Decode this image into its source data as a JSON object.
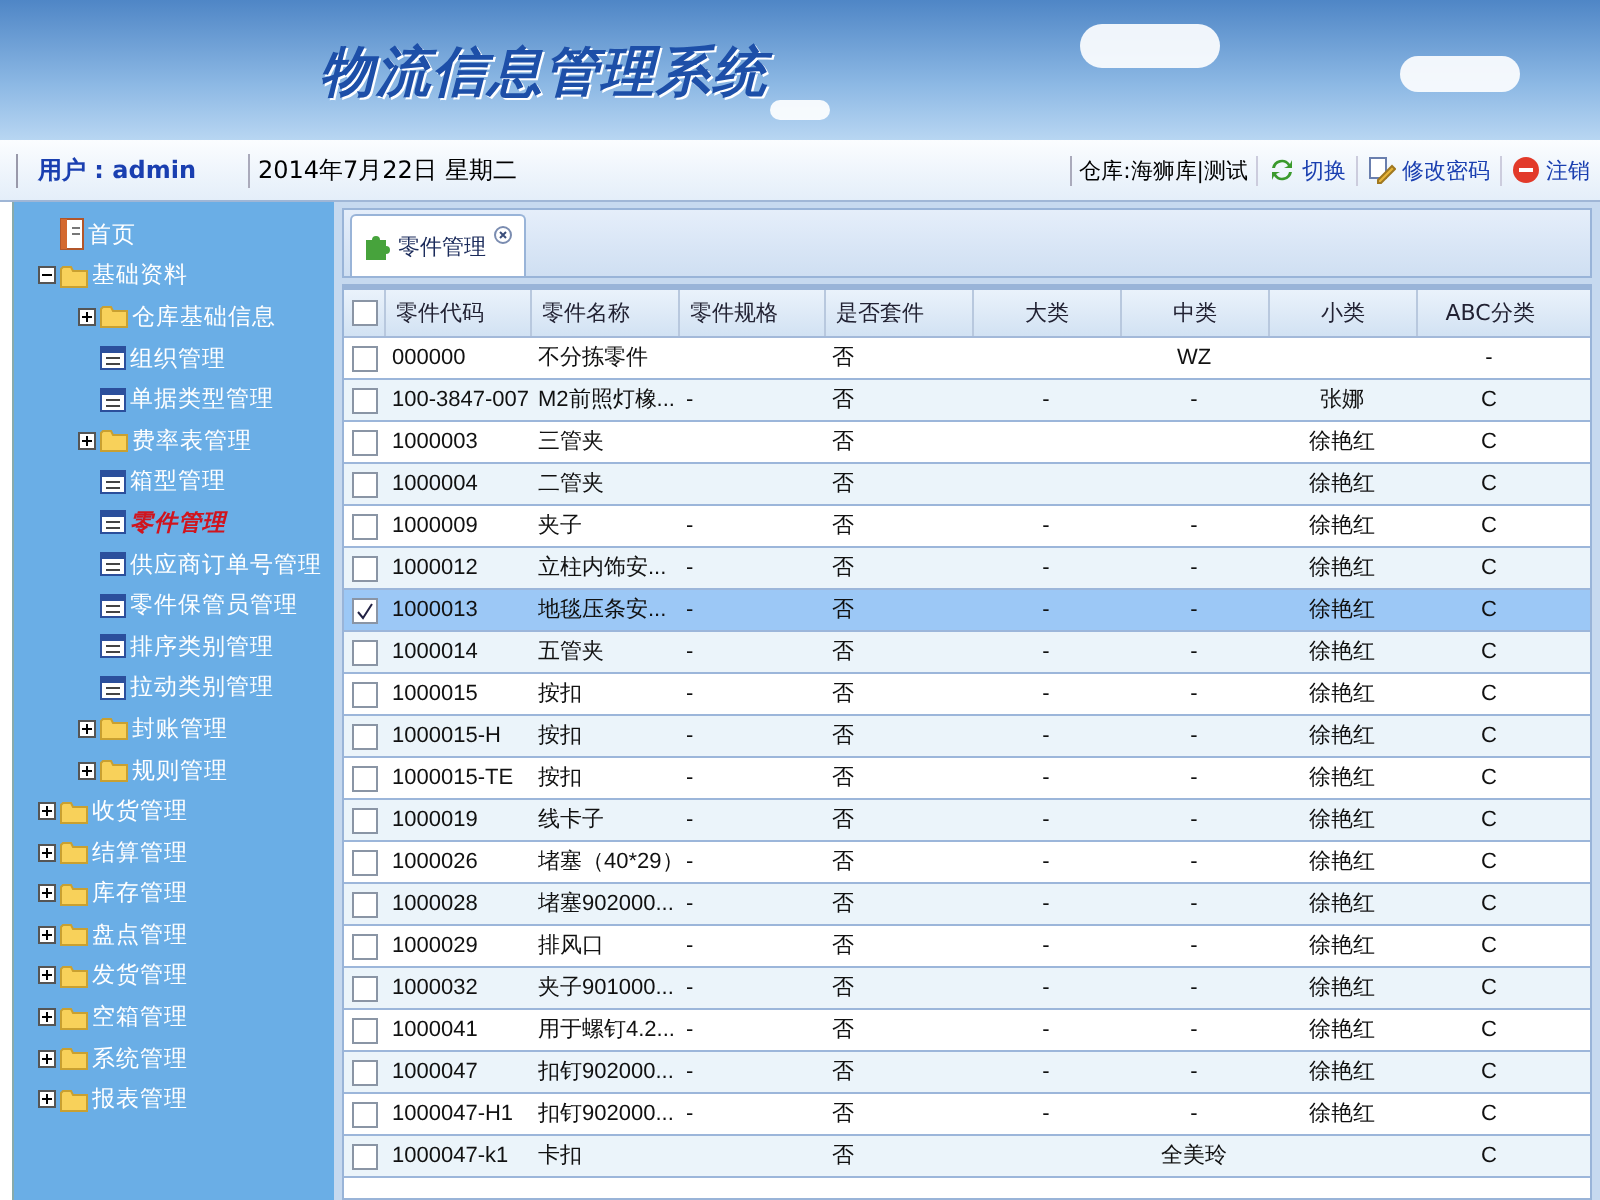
{
  "header": {
    "title": "物流信息管理系统"
  },
  "info_bar": {
    "user": "用户 : admin",
    "date": "2014年7月22日 星期二",
    "warehouse": "仓库:海狮库|测试",
    "actions": [
      {
        "kind": "switch",
        "label": "切换"
      },
      {
        "kind": "password",
        "label": "修改密码"
      },
      {
        "kind": "logout",
        "label": "注销"
      }
    ]
  },
  "sidebar": {
    "items": [
      {
        "kind": "home",
        "label": "首页",
        "selected": false
      },
      {
        "kind": "folder",
        "label": "基础资料",
        "selected": false,
        "expanded": true,
        "children": [
          {
            "kind": "folder",
            "label": "仓库基础信息",
            "selected": false,
            "expanded": false
          },
          {
            "kind": "page",
            "label": "组织管理",
            "selected": false
          },
          {
            "kind": "page",
            "label": "单据类型管理",
            "selected": false
          },
          {
            "kind": "folder",
            "label": "费率表管理",
            "selected": false,
            "expanded": false
          },
          {
            "kind": "page",
            "label": "箱型管理",
            "selected": false
          },
          {
            "kind": "page",
            "label": "零件管理",
            "selected": true
          },
          {
            "kind": "page",
            "label": "供应商订单号管理",
            "selected": false
          },
          {
            "kind": "page",
            "label": "零件保管员管理",
            "selected": false
          },
          {
            "kind": "page",
            "label": "排序类别管理",
            "selected": false
          },
          {
            "kind": "page",
            "label": "拉动类别管理",
            "selected": false
          },
          {
            "kind": "folder",
            "label": "封账管理",
            "selected": false,
            "expanded": false
          },
          {
            "kind": "folder",
            "label": "规则管理",
            "selected": false,
            "expanded": false
          }
        ]
      },
      {
        "kind": "folder",
        "label": "收货管理",
        "selected": false,
        "expanded": false
      },
      {
        "kind": "folder",
        "label": "结算管理",
        "selected": false,
        "expanded": false
      },
      {
        "kind": "folder",
        "label": "库存管理",
        "selected": false,
        "expanded": false
      },
      {
        "kind": "folder",
        "label": "盘点管理",
        "selected": false,
        "expanded": false
      },
      {
        "kind": "folder",
        "label": "发货管理",
        "selected": false,
        "expanded": false
      },
      {
        "kind": "folder",
        "label": "空箱管理",
        "selected": false,
        "expanded": false
      },
      {
        "kind": "folder",
        "label": "系统管理",
        "selected": false,
        "expanded": false
      },
      {
        "kind": "folder",
        "label": "报表管理",
        "selected": false,
        "expanded": false
      }
    ]
  },
  "tabs": [
    {
      "label": "零件管理",
      "selected": true
    }
  ],
  "table": {
    "select_all_checked": false,
    "columns": [
      {
        "label": "零件代码"
      },
      {
        "label": "零件名称"
      },
      {
        "label": "零件规格"
      },
      {
        "label": "是否套件"
      },
      {
        "label": "大类"
      },
      {
        "label": "中类"
      },
      {
        "label": "小类"
      },
      {
        "label": "ABC分类"
      }
    ],
    "rows": [
      {
        "checked": false,
        "cells": [
          "000000",
          "不分拣零件",
          "",
          "否",
          "",
          "WZ",
          "",
          "-"
        ]
      },
      {
        "checked": false,
        "cells": [
          "100-3847-007",
          "M2前照灯橡...",
          "-",
          "否",
          "-",
          "-",
          "张娜",
          "C"
        ]
      },
      {
        "checked": false,
        "cells": [
          "1000003",
          "三管夹",
          "",
          "否",
          "",
          "",
          "徐艳红",
          "C"
        ]
      },
      {
        "checked": false,
        "cells": [
          "1000004",
          "二管夹",
          "",
          "否",
          "",
          "",
          "徐艳红",
          "C"
        ]
      },
      {
        "checked": false,
        "cells": [
          "1000009",
          "夹子",
          "-",
          "否",
          "-",
          "-",
          "徐艳红",
          "C"
        ]
      },
      {
        "checked": false,
        "cells": [
          "1000012",
          "立柱内饰安...",
          "-",
          "否",
          "-",
          "-",
          "徐艳红",
          "C"
        ]
      },
      {
        "checked": true,
        "cells": [
          "1000013",
          "地毯压条安...",
          "-",
          "否",
          "-",
          "-",
          "徐艳红",
          "C"
        ]
      },
      {
        "checked": false,
        "cells": [
          "1000014",
          "五管夹",
          "-",
          "否",
          "-",
          "-",
          "徐艳红",
          "C"
        ]
      },
      {
        "checked": false,
        "cells": [
          "1000015",
          "按扣",
          "-",
          "否",
          "-",
          "-",
          "徐艳红",
          "C"
        ]
      },
      {
        "checked": false,
        "cells": [
          "1000015-H",
          "按扣",
          "-",
          "否",
          "-",
          "-",
          "徐艳红",
          "C"
        ]
      },
      {
        "checked": false,
        "cells": [
          "1000015-TE",
          "按扣",
          "-",
          "否",
          "-",
          "-",
          "徐艳红",
          "C"
        ]
      },
      {
        "checked": false,
        "cells": [
          "1000019",
          "线卡子",
          "-",
          "否",
          "-",
          "-",
          "徐艳红",
          "C"
        ]
      },
      {
        "checked": false,
        "cells": [
          "1000026",
          "堵塞（40*29）",
          "-",
          "否",
          "-",
          "-",
          "徐艳红",
          "C"
        ]
      },
      {
        "checked": false,
        "cells": [
          "1000028",
          "堵塞902000...",
          "-",
          "否",
          "-",
          "-",
          "徐艳红",
          "C"
        ]
      },
      {
        "checked": false,
        "cells": [
          "1000029",
          "排风口",
          "-",
          "否",
          "-",
          "-",
          "徐艳红",
          "C"
        ]
      },
      {
        "checked": false,
        "cells": [
          "1000032",
          "夹子901000...",
          "-",
          "否",
          "-",
          "-",
          "徐艳红",
          "C"
        ]
      },
      {
        "checked": false,
        "cells": [
          "1000041",
          "用于螺钉4.2...",
          "-",
          "否",
          "-",
          "-",
          "徐艳红",
          "C"
        ]
      },
      {
        "checked": false,
        "cells": [
          "1000047",
          "扣钉902000...",
          "-",
          "否",
          "-",
          "-",
          "徐艳红",
          "C"
        ]
      },
      {
        "checked": false,
        "cells": [
          "1000047-H1",
          "扣钉902000...",
          "-",
          "否",
          "-",
          "-",
          "徐艳红",
          "C"
        ]
      },
      {
        "checked": false,
        "cells": [
          "1000047-k1",
          "卡扣",
          "",
          "否",
          "",
          "全美玲",
          "",
          "C"
        ]
      }
    ]
  }
}
